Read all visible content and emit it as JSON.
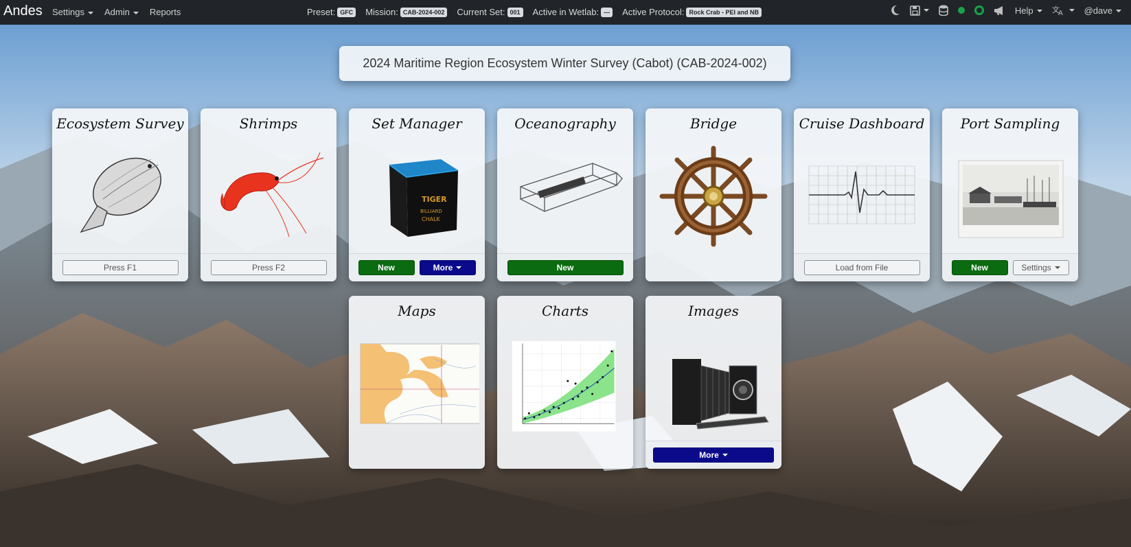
{
  "navbar": {
    "brand": "Andes",
    "menu": [
      {
        "label": "Settings"
      },
      {
        "label": "Admin"
      },
      {
        "label": "Reports"
      }
    ],
    "status": {
      "preset_label": "Preset:",
      "preset_value": "GFC",
      "mission_label": "Mission:",
      "mission_value": "CAB-2024-002",
      "set_label": "Current Set:",
      "set_value": "001",
      "wetlab_label": "Active in Wetlab:",
      "wetlab_value": "---",
      "protocol_label": "Active Protocol:",
      "protocol_value": "Rock Crab - PEI and NB"
    },
    "right": {
      "help_label": "Help",
      "user_label": "@dave",
      "status_color": "#1aa34a",
      "icons": [
        "moon-icon",
        "save-icon",
        "database-icon",
        "status-dot-icon",
        "sync-icon",
        "megaphone-icon",
        "translate-icon"
      ]
    }
  },
  "mission_title": "2024 Maritime Region Ecosystem Winter Survey (Cabot) (CAB-2024-002)",
  "cards": {
    "ecosystem": {
      "title": "Ecosystem Survey",
      "button": "Press F1",
      "image": "flounder"
    },
    "shrimps": {
      "title": "Shrimps",
      "button": "Press F2",
      "image": "shrimp"
    },
    "set_manager": {
      "title": "Set Manager",
      "new_button": "New",
      "more_button": "More",
      "image": "billiard-chalk",
      "chalk_brand": "TIGER",
      "chalk_text_1": "BILLIARD",
      "chalk_text_2": "CHALK"
    },
    "oceanography": {
      "title": "Oceanography",
      "new_button": "New",
      "image": "ctd-probe"
    },
    "bridge": {
      "title": "Bridge",
      "image": "ship-wheel"
    },
    "cruise_dashboard": {
      "title": "Cruise Dashboard",
      "button": "Load from File",
      "image": "ecg-trace"
    },
    "port_sampling": {
      "title": "Port Sampling",
      "new_button": "New",
      "settings_button": "Settings",
      "image": "harbour-photo"
    },
    "maps": {
      "title": "Maps",
      "image": "nautical-chart"
    },
    "charts": {
      "title": "Charts",
      "image": "scatter-chart"
    },
    "images": {
      "title": "Images",
      "more_button": "More",
      "image": "folding-camera"
    }
  },
  "colors": {
    "navbar_bg": "#212529",
    "green_button": "#0a6b10",
    "navy_button": "#0a0a8a",
    "badge_bg": "#d9dde1"
  }
}
